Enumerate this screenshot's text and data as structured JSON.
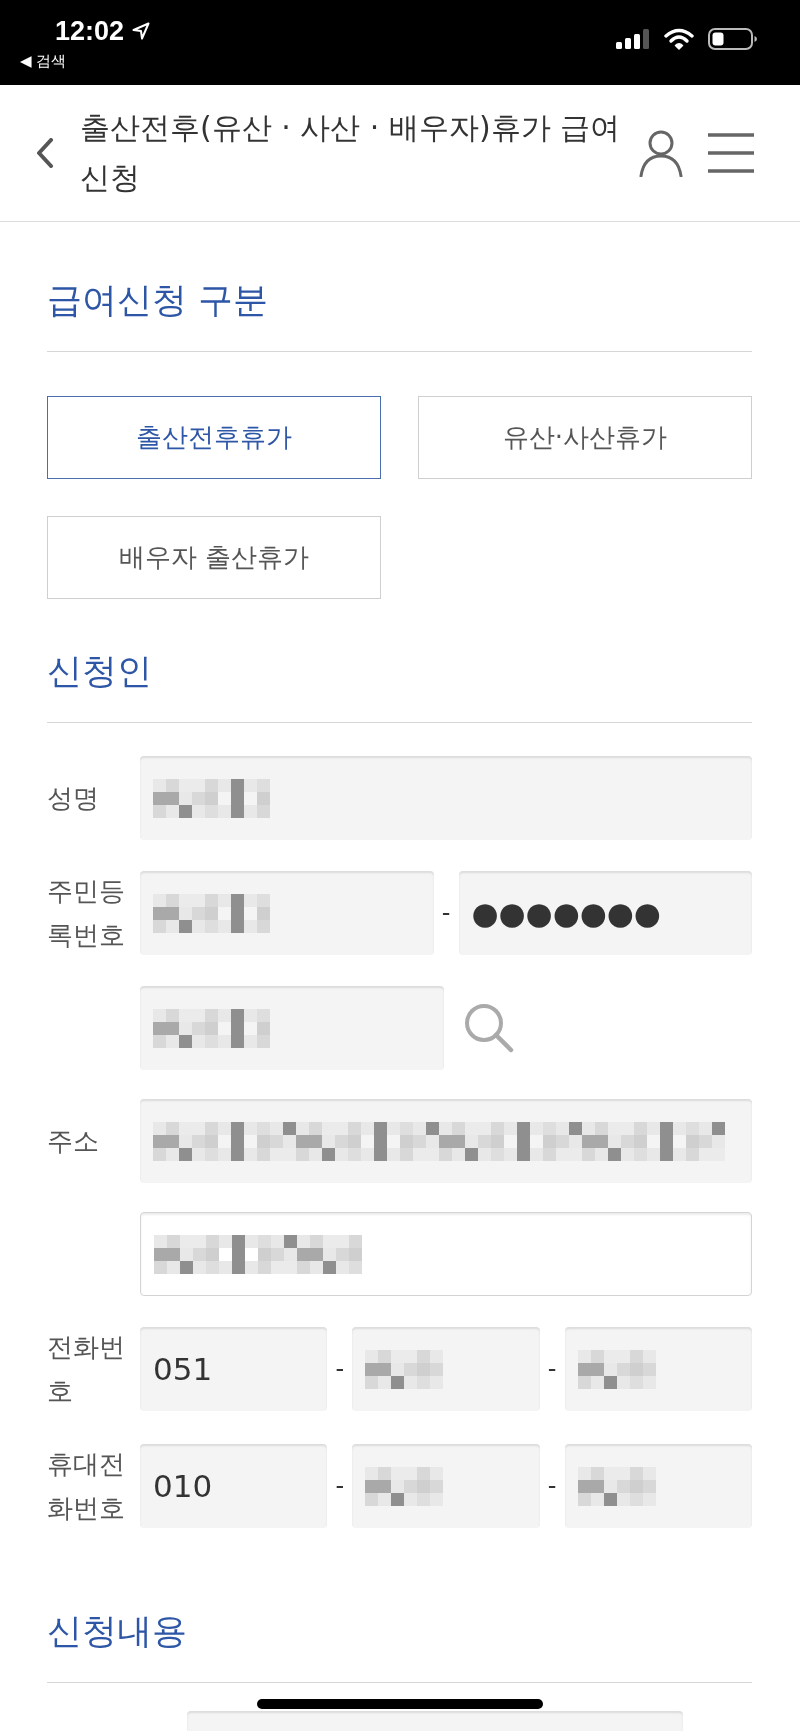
{
  "status_bar": {
    "time": "12:02",
    "back_link": "◀ 검색"
  },
  "header": {
    "title": "출산전후(유산 · 사산 · 배우자)휴가 급여 신청"
  },
  "sections": [
    {
      "kind": "choices",
      "title": "급여신청 구분",
      "options": [
        {
          "label": "출산전후휴가",
          "selected": true
        },
        {
          "label": "유산·사산휴가",
          "selected": false
        },
        {
          "label": "배우자 출산휴가",
          "selected": false
        }
      ]
    },
    {
      "kind": "form",
      "title": "신청인",
      "rows": [
        {
          "kind": "plain",
          "label": "성명",
          "fields": [
            {
              "kind": "filled",
              "redacted": true
            }
          ]
        },
        {
          "kind": "plain",
          "label": "주민등록번호",
          "separators": [
            "-"
          ],
          "fields": [
            {
              "kind": "filled",
              "redacted": true
            },
            {
              "kind": "filled",
              "value": "●●●●●●●"
            }
          ]
        },
        {
          "kind": "lookup",
          "fields": [
            {
              "kind": "filled",
              "redacted": true
            }
          ]
        },
        {
          "kind": "address",
          "label": "주소",
          "fields": [
            {
              "kind": "filled",
              "redacted": true
            }
          ]
        },
        {
          "kind": "address_detail",
          "fields": [
            {
              "kind": "outlined",
              "redacted": true
            }
          ]
        },
        {
          "kind": "phone",
          "label": "전화번호",
          "separators": [
            "-",
            "-"
          ],
          "fields": [
            {
              "kind": "filled",
              "value": "051"
            },
            {
              "kind": "filled",
              "redacted": true
            },
            {
              "kind": "filled",
              "redacted": true
            }
          ]
        },
        {
          "kind": "phone",
          "label": "휴대전화번호",
          "separators": [
            "-",
            "-"
          ],
          "fields": [
            {
              "kind": "filled",
              "value": "010"
            },
            {
              "kind": "filled",
              "redacted": true
            },
            {
              "kind": "filled",
              "redacted": true
            }
          ]
        }
      ]
    },
    {
      "kind": "form",
      "title": "신청내용",
      "rows": [
        {
          "kind": "cut",
          "fields": [
            {
              "kind": "filled"
            }
          ]
        }
      ]
    }
  ]
}
